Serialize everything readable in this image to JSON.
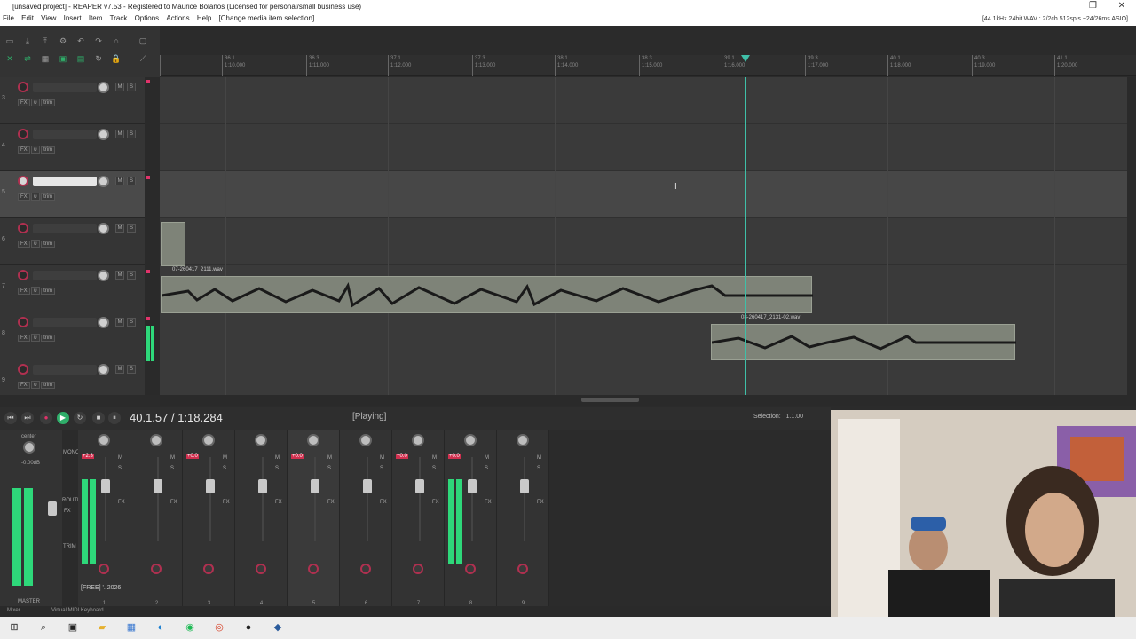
{
  "window": {
    "title": "[unsaved project] - REAPER v7.53 - Registered to Maurice Bolanos (Licensed for personal/small business use)"
  },
  "menu": {
    "items": [
      "File",
      "Edit",
      "View",
      "Insert",
      "Item",
      "Track",
      "Options",
      "Actions",
      "Help",
      "[Change media item selection]"
    ],
    "status": "[44.1kHz 24bit WAV : 2/2ch 512spls ~24/26ms ASIO]"
  },
  "ruler": {
    "marks": [
      {
        "bar": "",
        "time": ""
      },
      {
        "bar": "36.1",
        "time": "1:10.000"
      },
      {
        "bar": "36.3",
        "time": "1:11.000"
      },
      {
        "bar": "37.1",
        "time": "1:12.000"
      },
      {
        "bar": "37.3",
        "time": "1:13.000"
      },
      {
        "bar": "38.1",
        "time": "1:14.000"
      },
      {
        "bar": "38.3",
        "time": "1:15.000"
      },
      {
        "bar": "39.1",
        "time": "1:16.000"
      },
      {
        "bar": "39.3",
        "time": "1:17.000"
      },
      {
        "bar": "40.1",
        "time": "1:18.000"
      },
      {
        "bar": "40.3",
        "time": "1:19.000"
      },
      {
        "bar": "41.1",
        "time": "1:20.000"
      }
    ]
  },
  "tracks": [
    {
      "num": "3",
      "m": "M",
      "s": "S",
      "fx": "FX",
      "trim": "trim"
    },
    {
      "num": "4",
      "m": "M",
      "s": "S",
      "fx": "FX",
      "trim": "trim"
    },
    {
      "num": "5",
      "m": "M",
      "s": "S",
      "fx": "FX",
      "trim": "trim"
    },
    {
      "num": "6",
      "m": "M",
      "s": "S",
      "fx": "FX",
      "trim": "trim"
    },
    {
      "num": "7",
      "m": "M",
      "s": "S",
      "fx": "FX",
      "trim": "trim"
    },
    {
      "num": "8",
      "m": "M",
      "s": "S",
      "fx": "FX",
      "trim": "trim"
    },
    {
      "num": "9",
      "m": "M",
      "s": "S",
      "fx": "FX",
      "trim": "trim"
    }
  ],
  "items": {
    "item1_label": "07-260417_2111.wav",
    "item2_label": "08-260417_2131-02.wav"
  },
  "transport": {
    "timecode": "40.1.57 / 1:18.284",
    "state": "[Playing]",
    "selection_label": "Selection:",
    "selection_value": "1.1.00"
  },
  "mixer": {
    "master_label": "MASTER",
    "master_pan": "center",
    "master_db": "-0.00dB",
    "strip_labels": [
      "1",
      "2",
      "3",
      "4",
      "5",
      "6",
      "7",
      "8",
      "9"
    ],
    "first_strip_name": "[FREE] '..2026",
    "master_buttons": [
      "MONO",
      "FX",
      "ROUTE",
      "TRIM"
    ],
    "peak_values": [
      "+2.3",
      "",
      "+0.0",
      "",
      "+0.0",
      "",
      "+0.0",
      "+0.0",
      ""
    ]
  },
  "bottom": {
    "mixer_tab": "Mixer",
    "midi_tab": "Virtual MIDI Keyboard"
  },
  "colors": {
    "meter": "#2ed87a",
    "record": "#b03050",
    "playhead": "#3fc0a8",
    "edit_cursor": "#d2a83c"
  },
  "taskbar": {
    "icons": [
      "windows-icon",
      "search-icon",
      "task-view-icon",
      "file-explorer-icon",
      "calendar-icon",
      "edge-icon",
      "spotify-icon",
      "chrome-icon",
      "reaper-icon",
      "photoshop-icon"
    ]
  }
}
